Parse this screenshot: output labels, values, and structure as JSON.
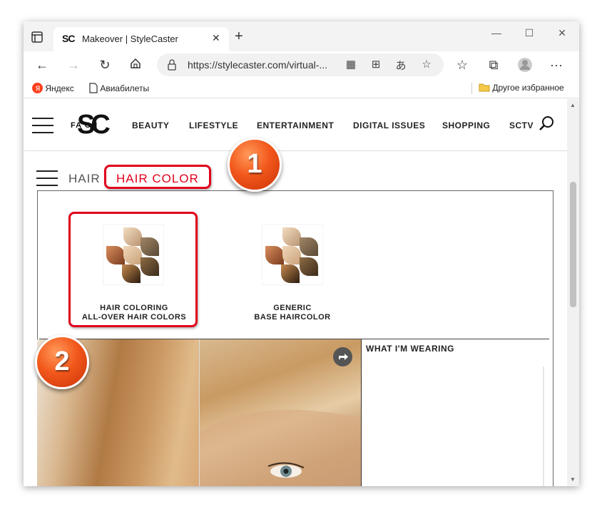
{
  "browser": {
    "tab_title": "Makeover | StyleCaster",
    "tab_favicon": "SC",
    "address": "https://stylecaster.com/virtual-...",
    "bookmarks": [
      {
        "label": "Яндекс",
        "icon": "yandex-icon"
      },
      {
        "label": "Авиабилеты",
        "icon": "page-icon"
      }
    ],
    "other_favorites": "Другое избранное"
  },
  "site": {
    "logo": "SC",
    "logo_under": "FA   ON",
    "nav": [
      "BEAUTY",
      "LIFESTYLE",
      "ENTERTAINMENT",
      "DIGITAL ISSUES",
      "SHOPPING",
      "SCTV"
    ]
  },
  "breadcrumb": {
    "parent": "HAIR",
    "current": "HAIR COLOR"
  },
  "swatches": [
    {
      "line1": "HAIR COLORING",
      "line2": "ALL-OVER HAIR COLORS"
    },
    {
      "line1": "GENERIC",
      "line2": "BASE HAIRCOLOR"
    }
  ],
  "markers": [
    "1",
    "2"
  ],
  "wearing_title": "WHAT I'M WEARING",
  "colors": {
    "accent_red": "#e0001b",
    "marker_orange": "#f2581b"
  }
}
